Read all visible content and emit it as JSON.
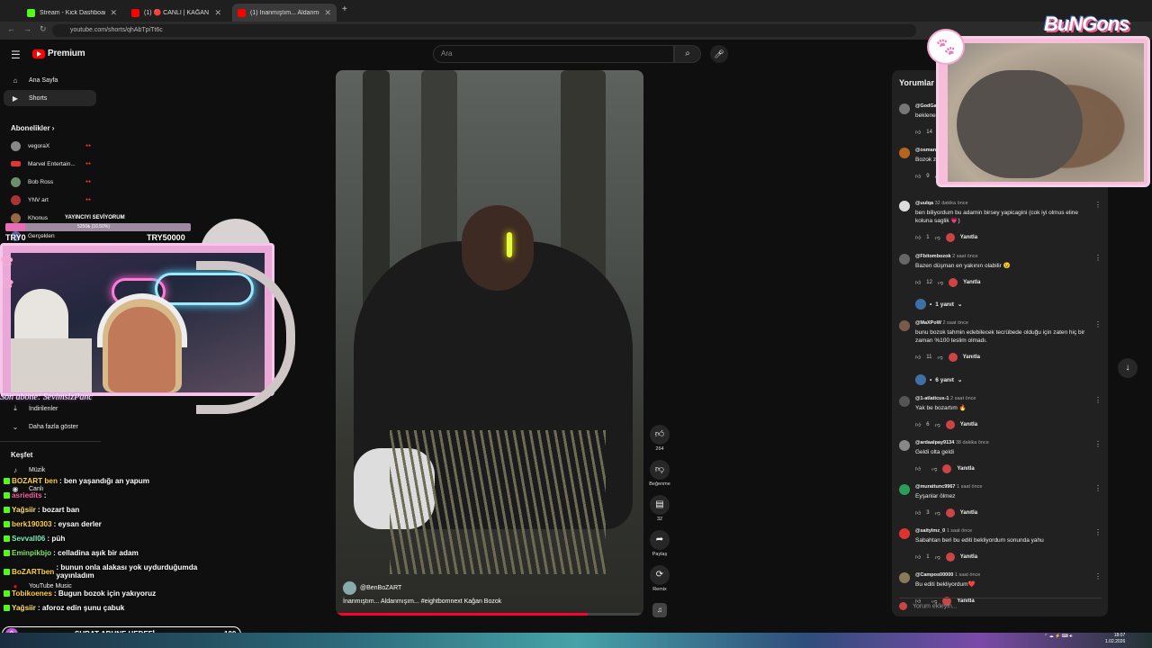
{
  "browser": {
    "tabs": [
      {
        "label": "Stream - Kick Dashboard",
        "color": "#53fc18"
      },
      {
        "label": "(1) 🔴 CANLI | KAĞAN BOZOK",
        "color": "#ff0000"
      },
      {
        "label": "(1) İnanmıştım... Aldanmışım...",
        "color": "#ff0000"
      }
    ],
    "url": "youtube.com/shorts/qhAbTpiTt6c"
  },
  "youtube": {
    "logo_text": "Premium",
    "search_placeholder": "Ara",
    "sidebar": {
      "items": [
        {
          "label": "Ana Sayfa",
          "icon": "home-icon"
        },
        {
          "label": "Shorts",
          "icon": "shorts-icon"
        }
      ],
      "subs_title": "Abonelikler",
      "subscriptions": [
        {
          "name": "vegoraX",
          "color": "#888"
        },
        {
          "name": "Marvel Entertain...",
          "color": "#e23636"
        },
        {
          "name": "Bob Ross",
          "color": "#6b8e6b"
        },
        {
          "name": "YNV art",
          "color": "#aa3333"
        },
        {
          "name": "Khonus",
          "color": "#996644"
        },
        {
          "name": "Gerçeklen",
          "color": "#5566aa"
        }
      ],
      "downloads": "İndirilenler",
      "more": "Daha fazla göster",
      "explore_title": "Keşfet",
      "explore_items": [
        "Müzik",
        "Canlı"
      ],
      "youtube_music": "YouTube Music"
    },
    "video": {
      "channel": "@BenBoZART",
      "title": "İnanmıştım... Aldanmışım... #eightbomnext Kağan Bozok",
      "progress": 0.82
    },
    "actions": [
      {
        "icon": "like-icon",
        "label": "264"
      },
      {
        "icon": "dislike-icon",
        "label": "Beğenme"
      },
      {
        "icon": "comment-icon",
        "label": "32"
      },
      {
        "icon": "share-icon",
        "label": "Paylaş"
      },
      {
        "icon": "remix-icon",
        "label": "Remix"
      },
      {
        "icon": "sound-icon",
        "label": ""
      }
    ],
    "comments": {
      "title": "Yorumlar",
      "reply_label": "Yanıtla",
      "add_placeholder": "Yorum ekleyin...",
      "items": [
        {
          "user": "@GodGa...",
          "time": "",
          "text": "beklenen...",
          "likes": "14",
          "color": "#777"
        },
        {
          "user": "@osman...",
          "time": "",
          "text": "Bozok za... diye, şah...",
          "likes": "9",
          "color": "#b5651d"
        },
        {
          "user": "@uulqa",
          "time": "32 dakika önce",
          "text": "ben biliyordum bu adamin birsey yapicagini (cok iyi olmus eline koluna saglik 💗)",
          "likes": "1",
          "color": "#ddd"
        },
        {
          "user": "@Fbitombozok",
          "time": "2 saat önce",
          "text": "Bazen düşman en yakının olabilir 😉",
          "likes": "12",
          "color": "#666"
        },
        {
          "user": "@MaXPoW",
          "time": "2 saat önce",
          "text": "bunu bozok tahmin edebilecek tecrübede olduğu için zaten hiç bir zaman %100 teslim olmadı.",
          "likes": "11",
          "color": "#7a5a4a"
        },
        {
          "user": "@1-atlaticus-1",
          "time": "2 saat önce",
          "text": "Yak be bozartım 🔥",
          "likes": "6",
          "color": "#555"
        },
        {
          "user": "@ardaalpay9134",
          "time": "38 dakika önce",
          "text": "Geldi olta geldi",
          "likes": "",
          "color": "#888"
        },
        {
          "user": "@murattunc9967",
          "time": "1 saat önce",
          "text": "Eyşanlar ölmez",
          "likes": "3",
          "color": "#2a9d5c"
        },
        {
          "user": "@saitylmz_0",
          "time": "1 saat önce",
          "text": "Sabahtan beri bu editi bekliyordum sonunda yahu",
          "likes": "1",
          "color": "#d33"
        },
        {
          "user": "@Campos00000",
          "time": "1 saat önce",
          "text": "Bu editi bekliyordum❤️",
          "likes": "",
          "color": "#8a7a5a"
        }
      ],
      "reply_threads": [
        "1 yanıt",
        "6 yanıt"
      ]
    }
  },
  "overlay": {
    "goal_title": "YAYINCIYI SEVİYORUM",
    "goal_amount": "5250₺ (10.50%)",
    "goal_progress": 0.105,
    "goal_left": "TRY0",
    "goal_right": "TRY50000",
    "last_sub": "Son abone: SevimsizPanc",
    "chat": [
      {
        "user": "BOZART ben",
        "msg": " : ben yaşandığı an yapum",
        "color": "#ffd23f"
      },
      {
        "user": "asriedits",
        "msg": " : ",
        "color": "#ff5ea2"
      },
      {
        "user": "Yağsiir",
        "msg": " : bozart ban",
        "color": "#ffe066"
      },
      {
        "user": "berk190303",
        "msg": " : eysan derler",
        "color": "#ffd23f"
      },
      {
        "user": "Sevvall06",
        "msg": " : püh",
        "color": "#7cf0c0"
      },
      {
        "user": "Eminpikbjo",
        "msg": " : celladina aşık bir adam",
        "color": "#84e66b"
      },
      {
        "user": "BoZARTben",
        "msg": " : bunun onla alakası yok uydurduğumda yayınladım",
        "color": "#ffd23f"
      },
      {
        "user": "Tobikoenes",
        "msg": " : Bugun bozok için yakıyoruz",
        "color": "#ffd23f"
      },
      {
        "user": "Yağsiir",
        "msg": " : aforoz edin şunu çabuk",
        "color": "#ffe066"
      }
    ],
    "sub_goal_title": "ŞUBAT ABUNE HEDEFİ",
    "sub_goal_count": "9",
    "sub_goal_target": "100",
    "brand_logo": "BuNGons"
  },
  "taskbar": {
    "time": "18:07",
    "date": "1.02.2026"
  }
}
